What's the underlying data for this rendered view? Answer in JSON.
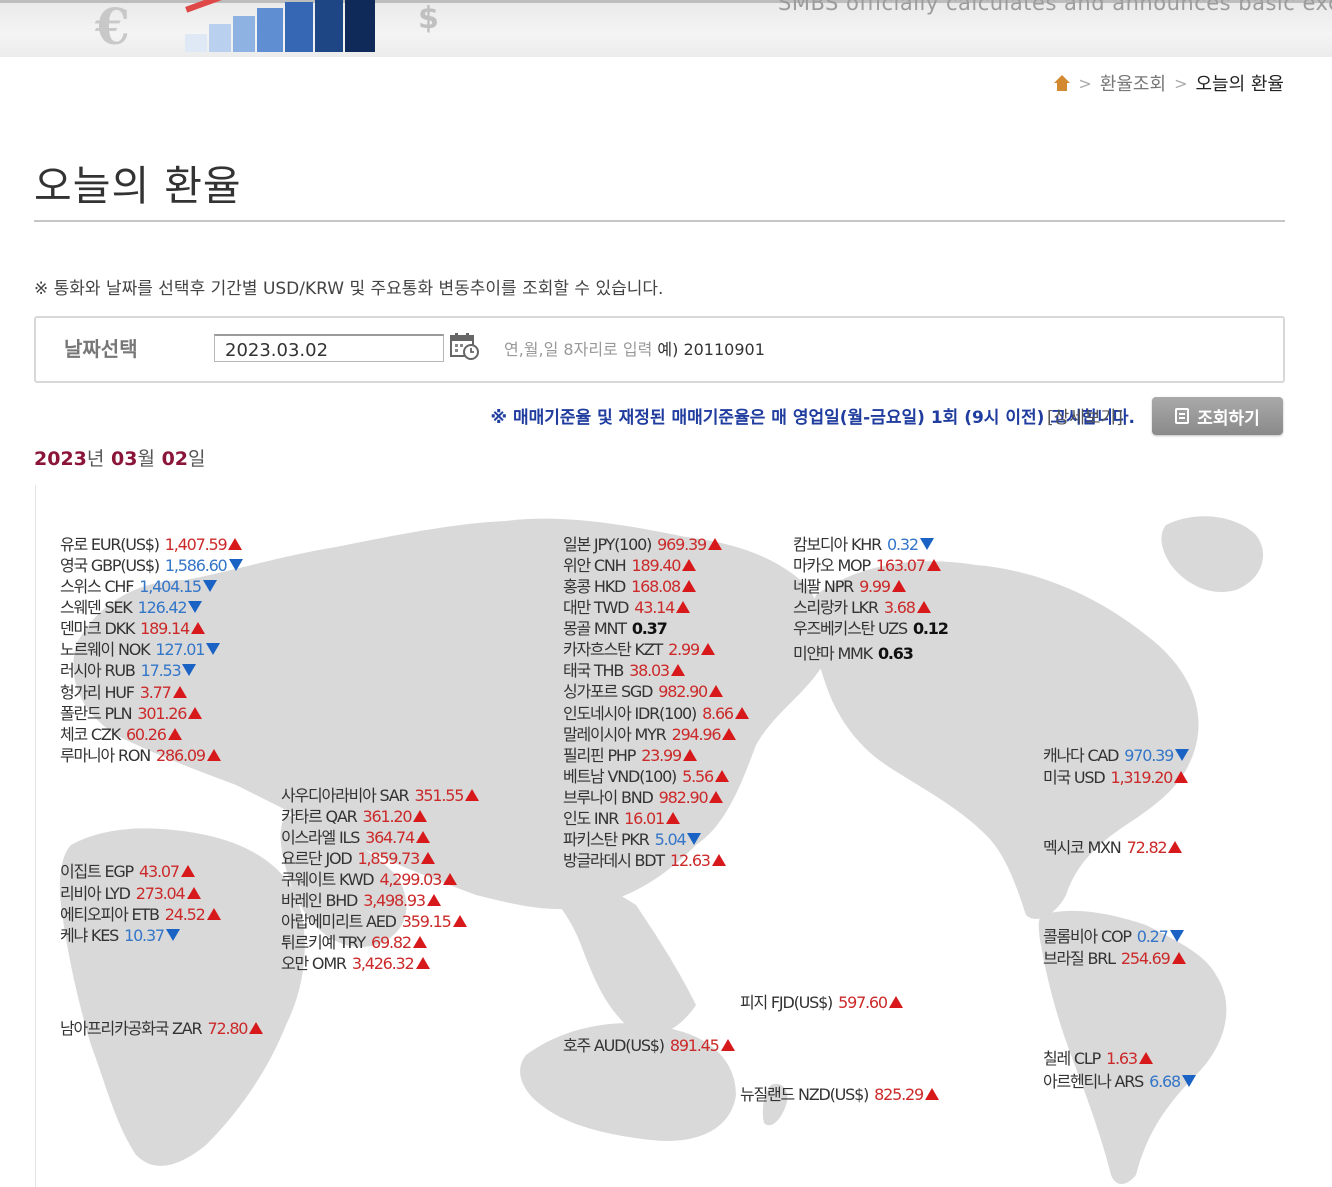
{
  "header": {
    "tagline": "SMBS officially calculates and announces basic exc",
    "breadcrumb": [
      "환율조회",
      "오늘의 환율"
    ]
  },
  "page": {
    "title": "오늘의 환율",
    "notice": "※ 통화와 날짜를 선택후 기간별 USD/KRW 및 주요통화 변동추이를 조회할 수 있습니다."
  },
  "date_form": {
    "label": "날짜선택",
    "value": "2023.03.02",
    "hint": "연,월,일 8자리로 입력",
    "example": "예) 20110901"
  },
  "announcement": "※ 매매기준율 및 재정된 매매기준율은 매 영업일(월-금요일) 1회 (9시 이전) 고시합니다.",
  "detail_link": "[상세보기]",
  "query_button": "조회하기",
  "date_heading": {
    "year": "2023",
    "year_unit": "년",
    "month": "03",
    "month_unit": "월",
    "day": "02",
    "day_unit": "일"
  },
  "colors": {
    "up": "#cc2a2a",
    "down": "#3476c8",
    "heading": "#8a1538",
    "notice": "#1f3c9e"
  },
  "rates": [
    {
      "name": "유로 EUR(US$)",
      "value": "1,407.59",
      "dir": "up"
    },
    {
      "name": "영국 GBP(US$)",
      "value": "1,586.60",
      "dir": "down"
    },
    {
      "name": "스위스 CHF",
      "value": "1,404.15",
      "dir": "down"
    },
    {
      "name": "스웨덴 SEK",
      "value": "126.42",
      "dir": "down"
    },
    {
      "name": "덴마크 DKK",
      "value": "189.14",
      "dir": "up"
    },
    {
      "name": "노르웨이 NOK",
      "value": "127.01",
      "dir": "down"
    },
    {
      "name": "러시아 RUB",
      "value": "17.53",
      "dir": "down"
    },
    {
      "name": "헝가리 HUF",
      "value": "3.77",
      "dir": "up"
    },
    {
      "name": "폴란드 PLN",
      "value": "301.26",
      "dir": "up"
    },
    {
      "name": "체코 CZK",
      "value": "60.26",
      "dir": "up"
    },
    {
      "name": "루마니아 RON",
      "value": "286.09",
      "dir": "up"
    },
    {
      "name": "이집트 EGP",
      "value": "43.07",
      "dir": "up"
    },
    {
      "name": "리비아 LYD",
      "value": "273.04",
      "dir": "up"
    },
    {
      "name": "에티오피아 ETB",
      "value": "24.52",
      "dir": "up"
    },
    {
      "name": "케냐 KES",
      "value": "10.37",
      "dir": "down"
    },
    {
      "name": "남아프리카공화국 ZAR",
      "value": "72.80",
      "dir": "up"
    },
    {
      "name": "사우디아라비아 SAR",
      "value": "351.55",
      "dir": "up"
    },
    {
      "name": "카타르 QAR",
      "value": "361.20",
      "dir": "up"
    },
    {
      "name": "이스라엘 ILS",
      "value": "364.74",
      "dir": "up"
    },
    {
      "name": "요르단 JOD",
      "value": "1,859.73",
      "dir": "up"
    },
    {
      "name": "쿠웨이트 KWD",
      "value": "4,299.03",
      "dir": "up"
    },
    {
      "name": "바레인 BHD",
      "value": "3,498.93",
      "dir": "up"
    },
    {
      "name": "아랍에미리트 AED",
      "value": "359.15",
      "dir": "up"
    },
    {
      "name": "튀르키예 TRY",
      "value": "69.82",
      "dir": "up"
    },
    {
      "name": "오만 OMR",
      "value": "3,426.32",
      "dir": "up"
    },
    {
      "name": "일본 JPY(100)",
      "value": "969.39",
      "dir": "up"
    },
    {
      "name": "위안 CNH",
      "value": "189.40",
      "dir": "up"
    },
    {
      "name": "홍콩 HKD",
      "value": "168.08",
      "dir": "up"
    },
    {
      "name": "대만 TWD",
      "value": "43.14",
      "dir": "up"
    },
    {
      "name": "몽골 MNT",
      "value": "0.37",
      "dir": "flat"
    },
    {
      "name": "카자흐스탄 KZT",
      "value": "2.99",
      "dir": "up"
    },
    {
      "name": "태국 THB",
      "value": "38.03",
      "dir": "up"
    },
    {
      "name": "싱가포르 SGD",
      "value": "982.90",
      "dir": "up"
    },
    {
      "name": "인도네시아 IDR(100)",
      "value": "8.66",
      "dir": "up"
    },
    {
      "name": "말레이시아 MYR",
      "value": "294.96",
      "dir": "up"
    },
    {
      "name": "필리핀 PHP",
      "value": "23.99",
      "dir": "up"
    },
    {
      "name": "베트남 VND(100)",
      "value": "5.56",
      "dir": "up"
    },
    {
      "name": "브루나이 BND",
      "value": "982.90",
      "dir": "up"
    },
    {
      "name": "인도 INR",
      "value": "16.01",
      "dir": "up"
    },
    {
      "name": "파키스탄 PKR",
      "value": "5.04",
      "dir": "down"
    },
    {
      "name": "방글라데시 BDT",
      "value": "12.63",
      "dir": "up"
    },
    {
      "name": "호주 AUD(US$)",
      "value": "891.45",
      "dir": "up"
    },
    {
      "name": "캄보디아 KHR",
      "value": "0.32",
      "dir": "down"
    },
    {
      "name": "마카오 MOP",
      "value": "163.07",
      "dir": "up"
    },
    {
      "name": "네팔 NPR",
      "value": "9.99",
      "dir": "up"
    },
    {
      "name": "스리랑카 LKR",
      "value": "3.68",
      "dir": "up"
    },
    {
      "name": "우즈베키스탄 UZS",
      "value": "0.12",
      "dir": "flat"
    },
    {
      "name": "미얀마 MMK",
      "value": "0.63",
      "dir": "flat"
    },
    {
      "name": "피지 FJD(US$)",
      "value": "597.60",
      "dir": "up"
    },
    {
      "name": "뉴질랜드 NZD(US$)",
      "value": "825.29",
      "dir": "up"
    },
    {
      "name": "캐나다 CAD",
      "value": "970.39",
      "dir": "down"
    },
    {
      "name": "미국 USD",
      "value": "1,319.20",
      "dir": "up"
    },
    {
      "name": "멕시코 MXN",
      "value": "72.82",
      "dir": "up"
    },
    {
      "name": "콜롬비아 COP",
      "value": "0.27",
      "dir": "down"
    },
    {
      "name": "브라질 BRL",
      "value": "254.69",
      "dir": "up"
    },
    {
      "name": "칠레 CLP",
      "value": "1.63",
      "dir": "up"
    },
    {
      "name": "아르헨티나 ARS",
      "value": "6.68",
      "dir": "down"
    }
  ]
}
